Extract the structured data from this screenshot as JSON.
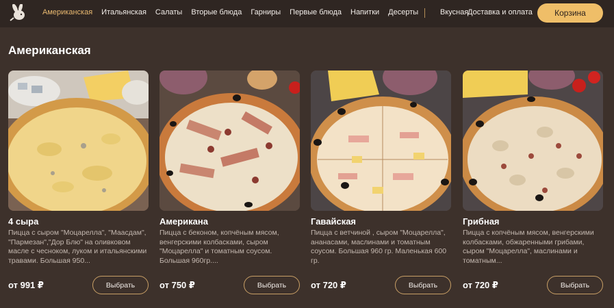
{
  "header": {
    "nav": [
      "Американская",
      "Итальянская",
      "Салаты",
      "Вторые блюда",
      "Гарниры",
      "Первые блюда",
      "Напитки",
      "Десерты"
    ],
    "links": [
      "Вкусная",
      "Доставка и оплата"
    ],
    "cart_label": "Корзина",
    "accent_color": "#e8b870"
  },
  "section": {
    "title": "Американская"
  },
  "products": [
    {
      "name": "4 сыра",
      "description": "Пицца с сыром \"Моцарелла\", \"Маасдам\", \"Пармезан\",\"Дор Блю\" на оливковом масле с чесноком, луком и итальянскими травами. Большая 950...",
      "price": "от 991 ₽",
      "button": "Выбрать"
    },
    {
      "name": "Американа",
      "description": "Пицца с беконом, копчёным мясом, венгерскими колбасками, сыром \"Моцарелла\" и томатным соусом. Большая 960гр....",
      "price": "от 750 ₽",
      "button": "Выбрать"
    },
    {
      "name": "Гавайская",
      "description": "Пицца с ветчиной , сыром \"Моцарелла\", ананасами, маслинами и томатным соусом. Большая 960 гр. Маленькая 600 гр.",
      "price": "от 720 ₽",
      "button": "Выбрать"
    },
    {
      "name": "Грибная",
      "description": "Пицца с копчёным мясом, венгерскими колбасками, обжаренными грибами, сыром \"Моцарелла\", маслинами и томатным...",
      "price": "от 720 ₽",
      "button": "Выбрать"
    }
  ]
}
